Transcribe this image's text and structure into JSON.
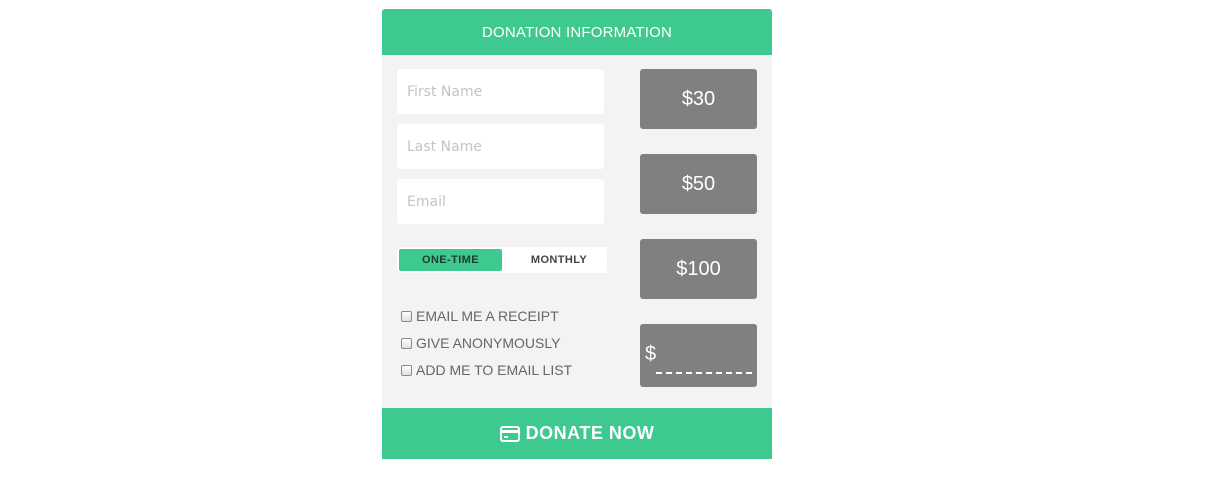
{
  "header": {
    "title": "DONATION INFORMATION"
  },
  "form": {
    "first_name_placeholder": "First Name",
    "last_name_placeholder": "Last Name",
    "email_placeholder": "Email"
  },
  "frequency": {
    "options": [
      "ONE-TIME",
      "MONTHLY"
    ],
    "selected": "ONE-TIME"
  },
  "checkboxes": [
    {
      "label": "EMAIL ME A RECEIPT",
      "checked": false
    },
    {
      "label": "GIVE ANONYMOUSLY",
      "checked": false
    },
    {
      "label": "ADD ME TO EMAIL LIST",
      "checked": false
    }
  ],
  "amounts": [
    "$30",
    "$50",
    "$100"
  ],
  "custom_amount": {
    "currency_symbol": "$",
    "value": ""
  },
  "donate_button": {
    "label": "DONATE NOW",
    "icon": "credit-card-icon"
  },
  "colors": {
    "accent": "#3ec98f",
    "amount_bg": "#808080",
    "panel_bg": "#f3f3f3"
  }
}
